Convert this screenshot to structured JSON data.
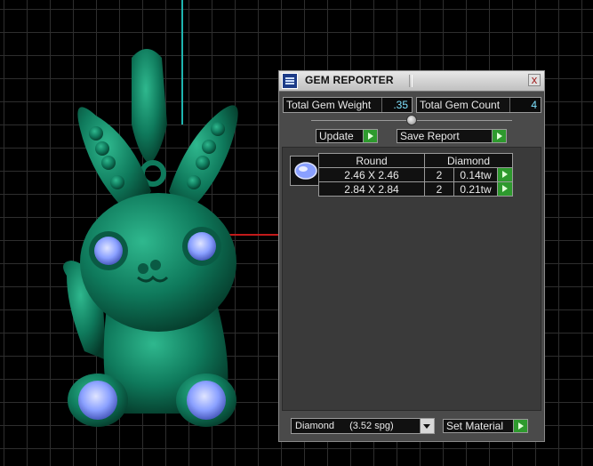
{
  "panel": {
    "title": "GEM REPORTER",
    "close_label": "x",
    "total_gem_weight_label": "Total Gem Weight",
    "total_gem_weight_value": ".35",
    "total_gem_count_label": "Total Gem Count",
    "total_gem_count_value": "4",
    "update_label": "Update",
    "save_report_label": "Save Report",
    "table": {
      "headers": [
        "Round",
        "Diamond"
      ],
      "rows": [
        {
          "size": "2.46 X 2.46",
          "count": "2",
          "weight": "0.14tw"
        },
        {
          "size": "2.84 X 2.84",
          "count": "2",
          "weight": "0.21tw"
        }
      ]
    },
    "material_select": {
      "value": "Diamond",
      "spg": "(3.52 spg)"
    },
    "set_material_label": "Set Material"
  },
  "colors": {
    "model_green": "#0f7a5c",
    "gem_blue": "#8aa0ff",
    "panel_bg": "#4a4a4a",
    "value_cyan": "#7fe3ff",
    "go_green": "#2e9a2e"
  }
}
